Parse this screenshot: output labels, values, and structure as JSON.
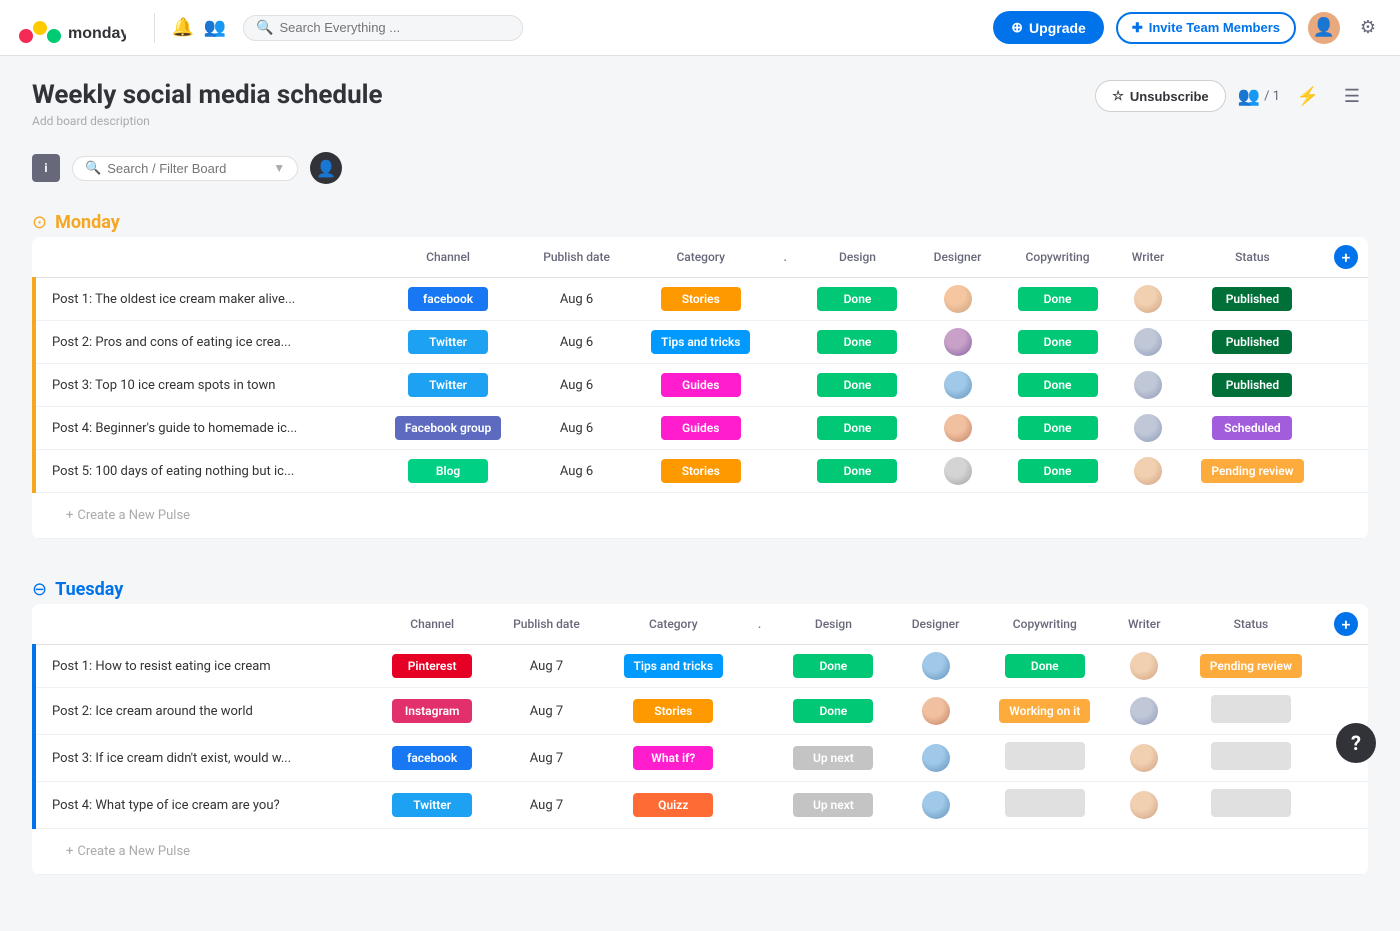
{
  "topnav": {
    "search_placeholder": "Search Everything ...",
    "upgrade_label": "Upgrade",
    "invite_label": "Invite Team Members",
    "bell_icon": "🔔",
    "people_icon": "👥",
    "menu_icon": "☰"
  },
  "board": {
    "title": "Weekly social media schedule",
    "description": "Add board description",
    "unsubscribe_label": "Unsubscribe",
    "members_count": "/ 1"
  },
  "toolbar": {
    "filter_placeholder": "Search / Filter Board"
  },
  "groups": [
    {
      "id": "monday",
      "title": "Monday",
      "color": "#f5a623",
      "columns": [
        "Channel",
        "Publish date",
        "Category",
        ".",
        "Design",
        "Designer",
        "Copywriting",
        "Writer",
        "Status"
      ],
      "rows": [
        {
          "title": "Post 1: The oldest ice cream maker alive...",
          "channel": "facebook",
          "channel_label": "facebook",
          "channel_class": "channel-facebook",
          "date": "Aug 6",
          "category": "Stories",
          "category_class": "cat-stories",
          "design": "Done",
          "design_class": "status-done",
          "designer_class": "da1",
          "copywriting": "Done",
          "copywriting_class": "status-done",
          "writer_class": "wa1",
          "status": "Published",
          "status_class": "status-published"
        },
        {
          "title": "Post 2: Pros and cons of eating ice crea...",
          "channel": "Twitter",
          "channel_label": "Twitter",
          "channel_class": "channel-twitter",
          "date": "Aug 6",
          "category": "Tips and tricks",
          "category_class": "cat-tips",
          "design": "Done",
          "design_class": "status-done",
          "designer_class": "da2",
          "copywriting": "Done",
          "copywriting_class": "status-done",
          "writer_class": "wa2",
          "status": "Published",
          "status_class": "status-published"
        },
        {
          "title": "Post 3: Top 10 ice cream spots in town",
          "channel": "Twitter",
          "channel_label": "Twitter",
          "channel_class": "channel-twitter",
          "date": "Aug 6",
          "category": "Guides",
          "category_class": "cat-guides",
          "design": "Done",
          "design_class": "status-done",
          "designer_class": "da3",
          "copywriting": "Done",
          "copywriting_class": "status-done",
          "writer_class": "wa2",
          "status": "Published",
          "status_class": "status-published"
        },
        {
          "title": "Post 4: Beginner's guide to homemade ic...",
          "channel": "Facebook group",
          "channel_label": "Facebook group",
          "channel_class": "channel-fbgroup",
          "date": "Aug 6",
          "category": "Guides",
          "category_class": "cat-guides",
          "design": "Done",
          "design_class": "status-done",
          "designer_class": "da4",
          "copywriting": "Done",
          "copywriting_class": "status-done",
          "writer_class": "wa2",
          "status": "Scheduled",
          "status_class": "status-scheduled"
        },
        {
          "title": "Post 5: 100 days of eating nothing but ic...",
          "channel": "Blog",
          "channel_label": "Blog",
          "channel_class": "channel-blog",
          "date": "Aug 6",
          "category": "Stories",
          "category_class": "cat-stories",
          "design": "Done",
          "design_class": "status-done",
          "designer_class": "da6",
          "copywriting": "Done",
          "copywriting_class": "status-done",
          "writer_class": "wa1",
          "status": "Pending review",
          "status_class": "status-pending"
        }
      ],
      "add_pulse": "+ Create a New Pulse"
    },
    {
      "id": "tuesday",
      "title": "Tuesday",
      "color": "#0073ea",
      "columns": [
        "Channel",
        "Publish date",
        "Category",
        ".",
        "Design",
        "Designer",
        "Copywriting",
        "Writer",
        "Status"
      ],
      "rows": [
        {
          "title": "Post 1: How to resist eating ice cream",
          "channel": "Pinterest",
          "channel_label": "Pinterest",
          "channel_class": "channel-pinterest",
          "date": "Aug 7",
          "category": "Tips and tricks",
          "category_class": "cat-tips",
          "design": "Done",
          "design_class": "status-done",
          "designer_class": "da3",
          "copywriting": "Done",
          "copywriting_class": "status-done",
          "writer_class": "wa1",
          "status": "Pending review",
          "status_class": "status-pending"
        },
        {
          "title": "Post 2: Ice cream around the world",
          "channel": "Instagram",
          "channel_label": "Instagram",
          "channel_class": "channel-instagram",
          "date": "Aug 7",
          "category": "Stories",
          "category_class": "cat-stories",
          "design": "Done",
          "design_class": "status-done",
          "designer_class": "da4",
          "copywriting": "Working on it",
          "copywriting_class": "status-working",
          "writer_class": "wa2",
          "status": "",
          "status_class": ""
        },
        {
          "title": "Post 3: If ice cream didn't exist, would w...",
          "channel": "facebook",
          "channel_label": "facebook",
          "channel_class": "channel-facebook",
          "date": "Aug 7",
          "category": "What if?",
          "category_class": "cat-whatif",
          "design": "Up next",
          "design_class": "status-upnext",
          "designer_class": "da3",
          "copywriting": "",
          "copywriting_class": "",
          "writer_class": "wa1",
          "status": "",
          "status_class": ""
        },
        {
          "title": "Post 4: What type of ice cream are you?",
          "channel": "Twitter",
          "channel_label": "Twitter",
          "channel_class": "channel-twitter",
          "date": "Aug 7",
          "category": "Quizz",
          "category_class": "cat-quizz",
          "design": "Up next",
          "design_class": "status-upnext",
          "designer_class": "da3",
          "copywriting": "",
          "copywriting_class": "",
          "writer_class": "wa1",
          "status": "",
          "status_class": ""
        }
      ],
      "add_pulse": "+ Create a New Pulse"
    }
  ],
  "help_btn": "?"
}
